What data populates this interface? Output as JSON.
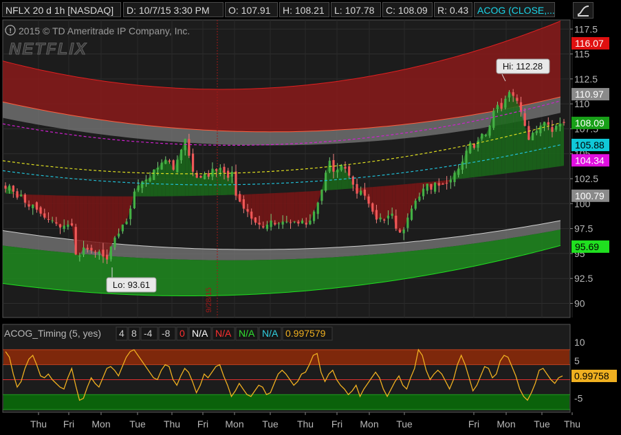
{
  "header": {
    "symbol": "NFLX 20 d 1h [NASDAQ]",
    "date": "D: 10/7/15 3:30 PM",
    "open": "O: 107.91",
    "high": "H: 108.21",
    "low": "L: 107.78",
    "close": "C: 108.09",
    "range": "R: 0.43",
    "study": "ACOG (CLOSE,..."
  },
  "copyright": "2015 © TD Ameritrade IP Company, Inc.",
  "watermark": "NETFLIX",
  "vline_label": "9/28/15",
  "colors": {
    "up": "#3a9a3a",
    "down": "#e04a4a",
    "bull_band": "#1f8a1f",
    "bear_band": "#8a1a1a",
    "grey_band": "#7a7a7a",
    "oscillator": "#f0b020"
  },
  "chart_data": [
    {
      "type": "candlestick",
      "ylim": [
        89,
        118
      ],
      "yticks": [
        90,
        92.5,
        95,
        97.5,
        100,
        102.5,
        105,
        107.5,
        110,
        112.5,
        115,
        117.5
      ],
      "ytick_labels": [
        "90",
        "92.5",
        "95",
        "97.5",
        "100",
        "102.5",
        "105",
        "107.5",
        "110",
        "112.5",
        "115",
        "117.5"
      ],
      "xticks": [
        "Thu",
        "Fri",
        "Mon",
        "Tue",
        "Thu",
        "Fri",
        "Mon",
        "Tue",
        "Thu",
        "Fri",
        "Mon",
        "Tue",
        "Fri",
        "Mon",
        "Tue",
        "Thu"
      ],
      "hi_label": "Hi: 112.28",
      "hi_value": 112.28,
      "lo_label": "Lo: 93.61",
      "lo_value": 93.61,
      "price_tags": [
        {
          "label": "116.07",
          "value": 116.07,
          "color": "#e01010",
          "text": "#ffffff"
        },
        {
          "label": "110.97",
          "value": 110.97,
          "color": "#8a8a8a",
          "text": "#ffffff"
        },
        {
          "label": "108.09",
          "value": 108.09,
          "color": "#18a018",
          "text": "#ffffff"
        },
        {
          "label": "105.88",
          "value": 105.88,
          "color": "#10c8d8",
          "text": "#000000"
        },
        {
          "label": "104.34",
          "value": 104.34,
          "color": "#e010e0",
          "text": "#ffffff"
        },
        {
          "label": "100.79",
          "value": 100.79,
          "color": "#8a8a8a",
          "text": "#ffffff"
        },
        {
          "label": "95.69",
          "value": 95.69,
          "color": "#20e020",
          "text": "#000000"
        }
      ],
      "closes": [
        101.5,
        101.8,
        101.2,
        100.6,
        100.9,
        100.1,
        99.7,
        99.9,
        99.4,
        99.0,
        98.6,
        98.4,
        98.3,
        98.0,
        97.6,
        97.8,
        97.9,
        97.8,
        94.9,
        94.8,
        95.6,
        95.4,
        95.3,
        95.1,
        95.2,
        94.7,
        94.4,
        95.7,
        96.6,
        97.0,
        97.9,
        98.2,
        99.5,
        101.2,
        101.8,
        102.2,
        102.4,
        102.6,
        103.4,
        103.6,
        104.1,
        104.4,
        104.2,
        103.4,
        104.4,
        105.4,
        106.5,
        104.8,
        103.2,
        102.6,
        102.6,
        103.0,
        102.7,
        103.5,
        103.3,
        103.6,
        103.1,
        102.6,
        103.2,
        100.8,
        100.2,
        99.5,
        99.2,
        98.5,
        98.1,
        97.9,
        97.6,
        97.9,
        98.3,
        97.9,
        98.0,
        98.2,
        98.2,
        98.1,
        98.2,
        98.0,
        98.3,
        97.9,
        98.3,
        99.2,
        100.1,
        101.4,
        103.1,
        104.3,
        103.2,
        103.4,
        103.9,
        103.5,
        102.8,
        101.9,
        101.0,
        101.3,
        100.8,
        100.0,
        99.2,
        98.4,
        98.6,
        98.3,
        98.8,
        99.0,
        97.5,
        97.1,
        97.4,
        98.6,
        99.5,
        100.3,
        100.7,
        101.5,
        102.0,
        101.4,
        102.1,
        101.8,
        101.9,
        102.0,
        102.4,
        103.1,
        103.5,
        104.2,
        105.3,
        106.1,
        105.6,
        106.3,
        107.0,
        106.9,
        107.8,
        109.3,
        109.9,
        109.5,
        110.5,
        111.2,
        110.8,
        110.3,
        109.2,
        107.8,
        106.4,
        107.1,
        107.3,
        107.8,
        108.2,
        107.9,
        107.2,
        107.8,
        108.0,
        108.09
      ],
      "mid_line": [],
      "oscillator_value_label": "0.99758"
    },
    {
      "type": "line",
      "title": "ACOG_Timing (5, yes)",
      "legend_values": [
        "4",
        "8",
        "-4",
        "-8",
        "0",
        "N/A",
        "N/A",
        "N/A",
        "N/A",
        "0.997579"
      ],
      "legend_colors": [
        "#cccccc",
        "#cccccc",
        "#cccccc",
        "#cccccc",
        "#ff3030",
        "#ffffff",
        "#ff3030",
        "#30e030",
        "#30d0e0",
        "#f0b020"
      ],
      "ylim": [
        -8,
        10
      ],
      "yticks": [
        10,
        5,
        -5
      ],
      "ytick_labels": [
        "10",
        "5",
        "-5"
      ],
      "bands": [
        {
          "from": 4,
          "to": 8,
          "color": "#8a2a0a"
        },
        {
          "from": -8,
          "to": -4,
          "color": "#0a6a0a"
        }
      ],
      "zero_line": 0,
      "last_value": 0.99758,
      "values": [
        7.5,
        6.0,
        1.5,
        -2.0,
        -0.5,
        3.0,
        5.5,
        6.5,
        4.0,
        1.0,
        0.5,
        1.5,
        0.0,
        -1.0,
        -2.0,
        -2.5,
        0.5,
        3.0,
        -1.5,
        -5.5,
        -5.0,
        -2.0,
        0.5,
        -1.0,
        -2.0,
        0.5,
        3.0,
        3.5,
        2.5,
        1.0,
        3.5,
        6.0,
        7.5,
        8.0,
        6.5,
        5.0,
        3.5,
        2.0,
        0.5,
        0.0,
        2.5,
        4.0,
        3.5,
        0.0,
        -1.5,
        1.0,
        3.0,
        2.0,
        -0.5,
        -3.5,
        -1.5,
        1.5,
        0.5,
        2.0,
        3.5,
        4.0,
        1.0,
        -1.5,
        -4.5,
        -3.0,
        -1.0,
        -2.5,
        -4.0,
        -4.5,
        -3.0,
        -1.5,
        -2.0,
        -4.0,
        -3.5,
        -1.0,
        1.5,
        2.5,
        1.5,
        0.0,
        -1.5,
        -0.5,
        1.5,
        2.0,
        4.0,
        6.5,
        7.0,
        2.0,
        -0.5,
        1.5,
        2.5,
        0.0,
        -1.5,
        -2.5,
        -4.0,
        -3.0,
        -1.5,
        -4.5,
        -2.5,
        -1.0,
        0.5,
        2.0,
        0.5,
        -2.5,
        -4.5,
        -2.5,
        -0.5,
        1.0,
        -1.5,
        -2.5,
        0.5,
        3.0,
        8.0,
        6.5,
        2.5,
        0.0,
        1.5,
        2.5,
        1.5,
        -0.5,
        -2.5,
        0.0,
        4.0,
        6.5,
        4.0,
        0.5,
        -3.0,
        -1.5,
        1.0,
        3.5,
        3.0,
        0.5,
        1.5,
        5.0,
        6.5,
        6.0,
        3.5,
        1.0,
        -2.5,
        -4.5,
        -5.5,
        -3.5,
        -1.0,
        2.5,
        3.0,
        1.5,
        0.0,
        -1.0,
        0.5,
        0.99758
      ]
    }
  ]
}
